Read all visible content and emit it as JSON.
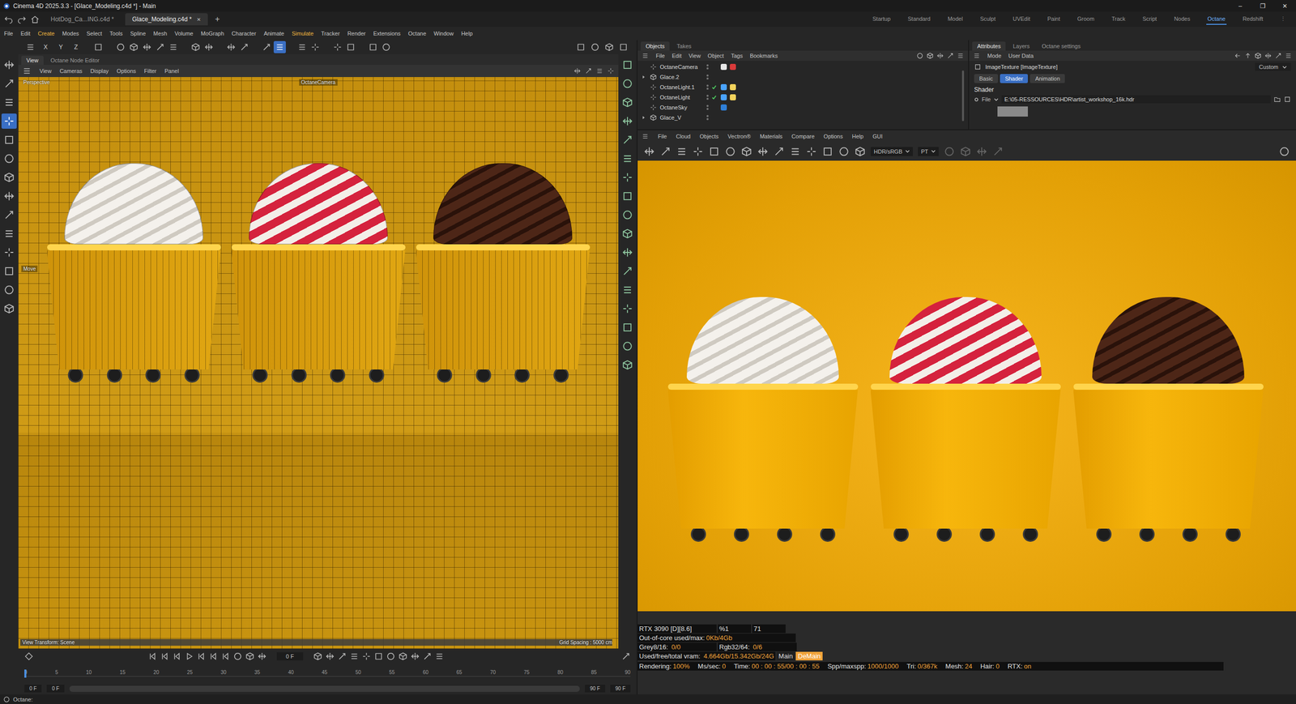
{
  "window": {
    "title": "Cinema 4D 2025.3.3 - [Glace_Modeling.c4d *] - Main",
    "controls": [
      "–",
      "❐",
      "✕"
    ]
  },
  "doc_tabs": [
    {
      "label": "HotDog_Ca...ING.c4d *",
      "selected": false
    },
    {
      "label": "Glace_Modeling.c4d *",
      "selected": true
    }
  ],
  "tab_close": "✕",
  "add_tab": "+",
  "layouts": [
    {
      "label": "Startup",
      "selected": false
    },
    {
      "label": "Standard",
      "selected": false
    },
    {
      "label": "Model",
      "selected": false
    },
    {
      "label": "Sculpt",
      "selected": false
    },
    {
      "label": "UVEdit",
      "selected": false
    },
    {
      "label": "Paint",
      "selected": false
    },
    {
      "label": "Groom",
      "selected": false
    },
    {
      "label": "Track",
      "selected": false
    },
    {
      "label": "Script",
      "selected": false
    },
    {
      "label": "Nodes",
      "selected": false
    },
    {
      "label": "Octane",
      "selected": true
    },
    {
      "label": "Redshift",
      "selected": false
    }
  ],
  "layout_more": "⋮",
  "menu": [
    {
      "label": "File",
      "highlighted": false
    },
    {
      "label": "Edit",
      "highlighted": false
    },
    {
      "label": "Create",
      "highlighted": true
    },
    {
      "label": "Modes",
      "highlighted": false
    },
    {
      "label": "Select",
      "highlighted": false
    },
    {
      "label": "Tools",
      "highlighted": false
    },
    {
      "label": "Spline",
      "highlighted": false
    },
    {
      "label": "Mesh",
      "highlighted": false
    },
    {
      "label": "Volume",
      "highlighted": false
    },
    {
      "label": "MoGraph",
      "highlighted": false
    },
    {
      "label": "Character",
      "highlighted": false
    },
    {
      "label": "Animate",
      "highlighted": false
    },
    {
      "label": "Simulate",
      "highlighted": true
    },
    {
      "label": "Tracker",
      "highlighted": false
    },
    {
      "label": "Render",
      "highlighted": false
    },
    {
      "label": "Extensions",
      "highlighted": false
    },
    {
      "label": "Octane",
      "highlighted": false
    },
    {
      "label": "Window",
      "highlighted": false
    },
    {
      "label": "Help",
      "highlighted": false
    }
  ],
  "toolbar": {
    "lead": [
      {
        "selected": false
      }
    ],
    "axes": [
      "X",
      "Y",
      "Z"
    ],
    "groups": [
      [
        {
          "selected": false
        }
      ],
      [
        {
          "selected": false
        },
        {
          "selected": false
        },
        {
          "selected": false
        },
        {
          "selected": false
        },
        {
          "selected": false
        }
      ],
      [
        {
          "selected": false
        },
        {
          "selected": false
        }
      ],
      [
        {
          "selected": false
        },
        {
          "selected": false
        }
      ],
      [
        {
          "selected": false
        },
        {
          "selected": true
        }
      ],
      [
        {
          "selected": false
        },
        {
          "selected": false
        }
      ],
      [
        {
          "selected": false
        },
        {
          "selected": false
        }
      ],
      [
        {
          "selected": false
        },
        {
          "selected": false
        }
      ]
    ],
    "right": [
      {
        "selected": false
      },
      {
        "selected": false
      },
      {
        "selected": false
      },
      {
        "selected": false
      }
    ]
  },
  "tools": [
    {
      "selected": false
    },
    {
      "selected": false
    },
    {
      "selected": false
    },
    {
      "selected": true
    },
    {
      "selected": false
    },
    {
      "selected": false
    },
    {
      "selected": false
    },
    {
      "selected": false
    },
    {
      "selected": false
    },
    {
      "selected": false
    },
    {
      "selected": false
    },
    {
      "selected": false
    },
    {
      "selected": false
    },
    {
      "selected": false
    }
  ],
  "side_tools": [
    {
      "selected": false
    },
    {
      "selected": false
    },
    {
      "selected": false
    },
    {
      "selected": false
    },
    {
      "selected": false
    },
    {
      "selected": false
    },
    {
      "selected": false
    },
    {
      "selected": false
    },
    {
      "selected": false
    },
    {
      "selected": false
    },
    {
      "selected": false
    },
    {
      "selected": false
    },
    {
      "selected": false
    },
    {
      "selected": false
    },
    {
      "selected": false
    },
    {
      "selected": false
    },
    {
      "selected": false
    }
  ],
  "viewport": {
    "tabs": [
      {
        "label": "View",
        "selected": true
      },
      {
        "label": "Octane Node Editor",
        "selected": false
      }
    ],
    "menu": [
      "View",
      "Cameras",
      "Display",
      "Options",
      "Filter",
      "Panel"
    ],
    "camera_label": "Perspective",
    "camera_name": "OctaneCamera",
    "tool_hint": "Move",
    "view_transform": "View Transform: Scene",
    "grid_spacing": "Grid Spacing : 5000 cm"
  },
  "timeline": {
    "frame": "0 F",
    "ticks": [
      "0",
      "5",
      "10",
      "15",
      "20",
      "25",
      "30",
      "35",
      "40",
      "45",
      "50",
      "55",
      "60",
      "65",
      "70",
      "75",
      "80",
      "85",
      "90"
    ],
    "playhead": 0,
    "start": "0 F",
    "min": "0 F",
    "max": "90 F",
    "end": "90 F"
  },
  "status_bar": {
    "text": "Octane:"
  },
  "objects": {
    "tabs": [
      {
        "label": "Objects",
        "selected": true
      },
      {
        "label": "Takes",
        "selected": false
      }
    ],
    "menu": [
      "File",
      "Edit",
      "View",
      "Object",
      "Tags",
      "Bookmarks"
    ],
    "rows": [
      {
        "name": "OctaneCamera",
        "expandable": false,
        "checked": false,
        "tags": [
          {
            "color": "#e6e6e6"
          },
          {
            "color": "#d93a3a"
          }
        ]
      },
      {
        "name": "Glace.2",
        "expandable": true,
        "checked": false,
        "tags": []
      },
      {
        "name": "OctaneLight.1",
        "expandable": false,
        "checked": true,
        "tags": [
          {
            "color": "#4aa3ff"
          },
          {
            "color": "#f2d25c"
          }
        ]
      },
      {
        "name": "OctaneLight",
        "expandable": false,
        "checked": true,
        "tags": [
          {
            "color": "#4aa3ff"
          },
          {
            "color": "#f2d25c"
          }
        ]
      },
      {
        "name": "OctaneSky",
        "expandable": false,
        "checked": false,
        "tags": [
          {
            "color": "#2f7fd8"
          }
        ]
      },
      {
        "name": "Glace_V",
        "expandable": true,
        "checked": false,
        "tags": []
      }
    ]
  },
  "attributes": {
    "tabs": [
      {
        "label": "Attributes",
        "selected": true
      },
      {
        "label": "Layers",
        "selected": false
      },
      {
        "label": "Octane settings",
        "selected": false
      }
    ],
    "menu": [
      "Mode",
      "User Data"
    ],
    "object": "ImageTexture [ImageTexture]",
    "preset": "Custom",
    "subtabs": [
      {
        "label": "Basic",
        "selected": false
      },
      {
        "label": "Shader",
        "selected": true
      },
      {
        "label": "Animation",
        "selected": false
      }
    ],
    "section": "Shader",
    "field_label": "File",
    "field_value": "E:\\05-RESSOURCES\\HDR\\artist_workshop_16k.hdr"
  },
  "octane": {
    "menu": [
      "File",
      "Cloud",
      "Objects",
      "Vectron®",
      "Materials",
      "Compare",
      "Options",
      "Help",
      "GUI"
    ],
    "color_space": "HDR/sRGB",
    "kernel": "PT",
    "gpu": {
      "name": "RTX 3090 [D][8.6]",
      "percent": "%1",
      "temp": "71"
    },
    "memory": [
      {
        "label": "Out-of-core used/max:",
        "value": "0Kb/4Gb"
      }
    ],
    "textures": [
      {
        "label": "Grey8/16:",
        "value": "0/0"
      },
      {
        "label": "Rgb32/64:",
        "value": "0/6"
      }
    ],
    "vram": {
      "label": "Used/free/total vram:",
      "value": "4.664Gb/15.342Gb/24G"
    },
    "badges": [
      {
        "label": "Main",
        "selected": false
      },
      {
        "label": "DeMain",
        "selected": true
      }
    ],
    "render": [
      {
        "label": "Rendering:",
        "value": "100%"
      },
      {
        "label": "Ms/sec:",
        "value": "0"
      },
      {
        "label": "Time:",
        "value": "00 : 00 : 55/00 : 00 : 55"
      },
      {
        "label": "Spp/maxspp:",
        "value": "1000/1000"
      },
      {
        "label": "Tri:",
        "value": "0/367k"
      },
      {
        "label": "Mesh:",
        "value": "24"
      },
      {
        "label": "Hair:",
        "value": "0"
      },
      {
        "label": "RTX:",
        "value": "on"
      }
    ]
  }
}
